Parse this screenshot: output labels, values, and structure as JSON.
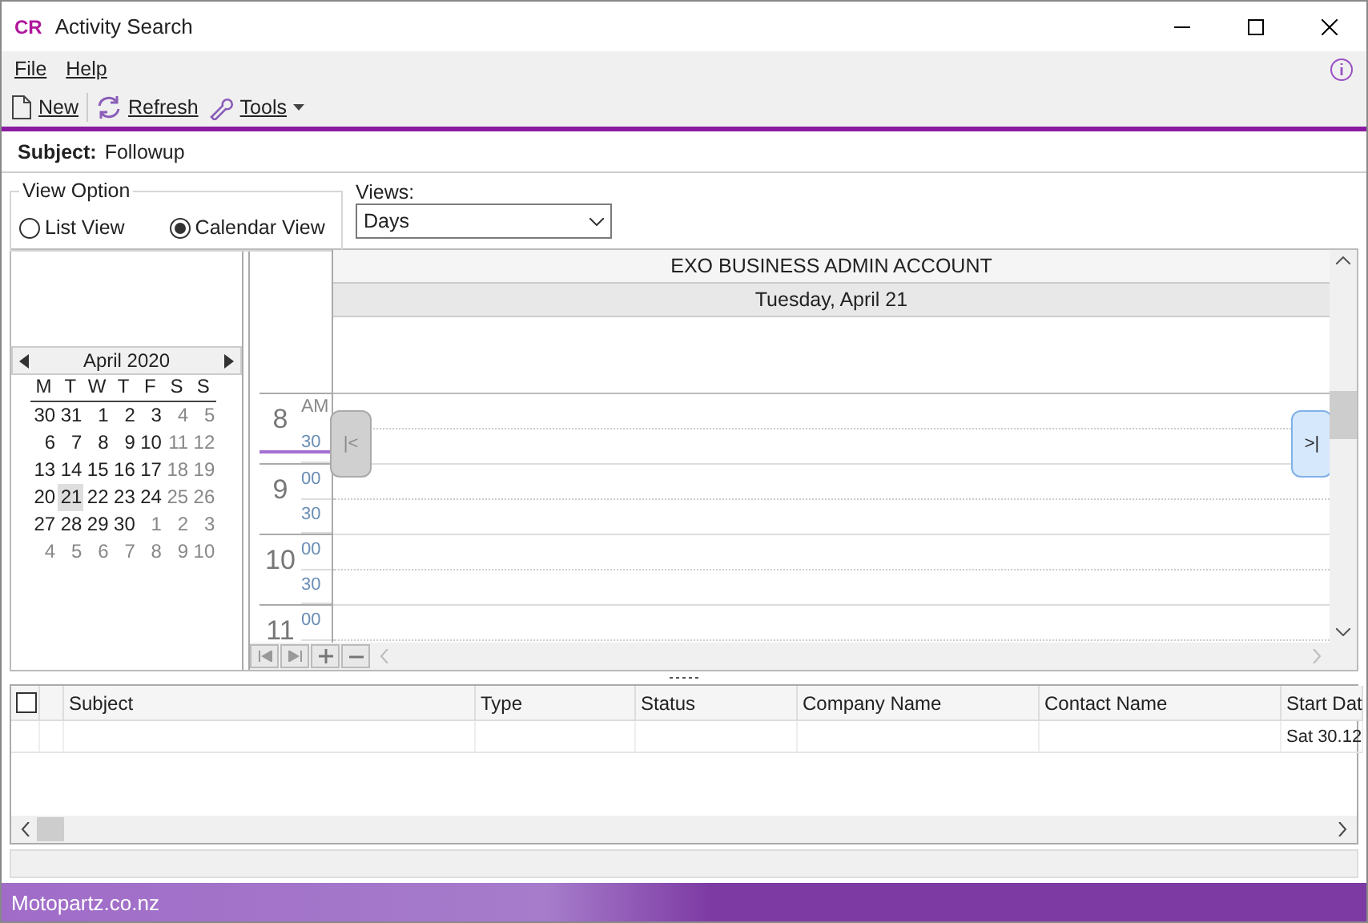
{
  "window": {
    "logo": "CR",
    "title": "Activity Search"
  },
  "menu": [
    {
      "label": "File"
    },
    {
      "label": "Help"
    }
  ],
  "toolbar": [
    {
      "kind": "new",
      "label": "New"
    },
    {
      "kind": "refresh",
      "label": "Refresh"
    },
    {
      "kind": "tools",
      "label": "Tools"
    }
  ],
  "subject": {
    "label": "Subject:",
    "value": "Followup"
  },
  "view_option": {
    "title": "View Option",
    "options": [
      {
        "label": "List View",
        "selected": false
      },
      {
        "label": "Calendar View",
        "selected": true
      }
    ]
  },
  "views": {
    "label": "Views:",
    "value": "Days"
  },
  "mini_calendar": {
    "month": "April 2020",
    "weekdays": [
      "M",
      "T",
      "W",
      "T",
      "F",
      "S",
      "S"
    ],
    "weeks": [
      [
        {
          "day": "30",
          "muted": false,
          "selected": false
        },
        {
          "day": "31",
          "muted": false,
          "selected": false
        },
        {
          "day": "1",
          "muted": false,
          "selected": false
        },
        {
          "day": "2",
          "muted": false,
          "selected": false
        },
        {
          "day": "3",
          "muted": false,
          "selected": false
        },
        {
          "day": "4",
          "muted": true,
          "selected": false
        },
        {
          "day": "5",
          "muted": true,
          "selected": false
        }
      ],
      [
        {
          "day": "6",
          "muted": false,
          "selected": false
        },
        {
          "day": "7",
          "muted": false,
          "selected": false
        },
        {
          "day": "8",
          "muted": false,
          "selected": false
        },
        {
          "day": "9",
          "muted": false,
          "selected": false
        },
        {
          "day": "10",
          "muted": false,
          "selected": false
        },
        {
          "day": "11",
          "muted": true,
          "selected": false
        },
        {
          "day": "12",
          "muted": true,
          "selected": false
        }
      ],
      [
        {
          "day": "13",
          "muted": false,
          "selected": false
        },
        {
          "day": "14",
          "muted": false,
          "selected": false
        },
        {
          "day": "15",
          "muted": false,
          "selected": false
        },
        {
          "day": "16",
          "muted": false,
          "selected": false
        },
        {
          "day": "17",
          "muted": false,
          "selected": false
        },
        {
          "day": "18",
          "muted": true,
          "selected": false
        },
        {
          "day": "19",
          "muted": true,
          "selected": false
        }
      ],
      [
        {
          "day": "20",
          "muted": false,
          "selected": false
        },
        {
          "day": "21",
          "muted": false,
          "selected": true
        },
        {
          "day": "22",
          "muted": false,
          "selected": false
        },
        {
          "day": "23",
          "muted": false,
          "selected": false
        },
        {
          "day": "24",
          "muted": false,
          "selected": false
        },
        {
          "day": "25",
          "muted": true,
          "selected": false
        },
        {
          "day": "26",
          "muted": true,
          "selected": false
        }
      ],
      [
        {
          "day": "27",
          "muted": false,
          "selected": false
        },
        {
          "day": "28",
          "muted": false,
          "selected": false
        },
        {
          "day": "29",
          "muted": false,
          "selected": false
        },
        {
          "day": "30",
          "muted": false,
          "selected": false
        },
        {
          "day": "1",
          "muted": true,
          "selected": false
        },
        {
          "day": "2",
          "muted": true,
          "selected": false
        },
        {
          "day": "3",
          "muted": true,
          "selected": false
        }
      ],
      [
        {
          "day": "4",
          "muted": true,
          "selected": false
        },
        {
          "day": "5",
          "muted": true,
          "selected": false
        },
        {
          "day": "6",
          "muted": true,
          "selected": false
        },
        {
          "day": "7",
          "muted": true,
          "selected": false
        },
        {
          "day": "8",
          "muted": true,
          "selected": false
        },
        {
          "day": "9",
          "muted": true,
          "selected": false
        },
        {
          "day": "10",
          "muted": true,
          "selected": false
        }
      ]
    ]
  },
  "scheduler": {
    "resource": "EXO BUSINESS ADMIN ACCOUNT",
    "date": "Tuesday, April 21",
    "hours": [
      {
        "hour": "8",
        "suffix": "AM",
        "minutes": [
          "30"
        ]
      },
      {
        "hour": "9",
        "minutes": [
          "00",
          "30"
        ]
      },
      {
        "hour": "10",
        "minutes": [
          "00",
          "30"
        ]
      },
      {
        "hour": "11",
        "minutes": [
          "00"
        ]
      }
    ],
    "prev_button": "|<",
    "next_button": ">|"
  },
  "grid": {
    "columns": [
      "Subject",
      "Type",
      "Status",
      "Company Name",
      "Contact Name",
      "Start Dat"
    ],
    "rows": [
      [
        "",
        "",
        "",
        "",
        "",
        "Sat 30.12"
      ]
    ]
  },
  "status_bar": {
    "text": "Motopartz.co.nz"
  }
}
